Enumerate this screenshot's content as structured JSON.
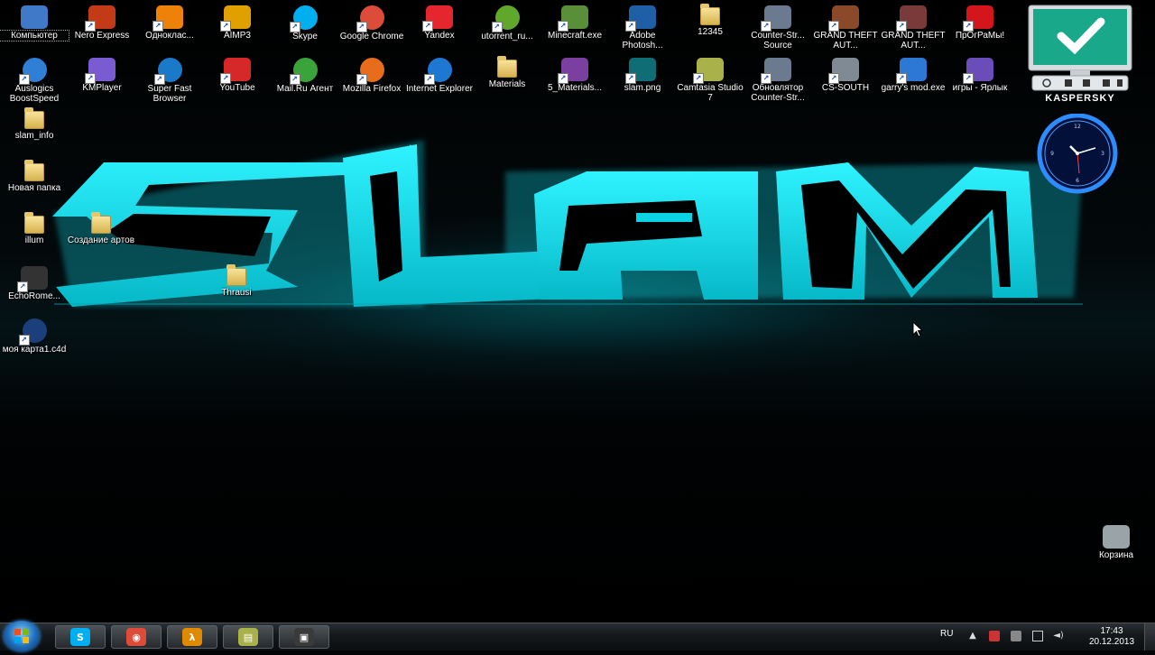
{
  "desktop_icons": [
    {
      "label": "Компьютер",
      "icon": "computer-icon",
      "color": "#3f79c8"
    },
    {
      "label": "Nero Express",
      "icon": "nero-icon",
      "color": "#c23a16"
    },
    {
      "label": "Одноклас...",
      "icon": "odnoklassniki-icon",
      "color": "#ee8208"
    },
    {
      "label": "AIMP3",
      "icon": "aimp-icon",
      "color": "#e0a100"
    },
    {
      "label": "Skype",
      "icon": "skype-icon",
      "color": "#00aff0"
    },
    {
      "label": "Google Chrome",
      "icon": "chrome-icon",
      "color": "#dd4b39"
    },
    {
      "label": "Yandex",
      "icon": "yandex-icon",
      "color": "#e6262e"
    },
    {
      "label": "utorrent_ru...",
      "icon": "utorrent-icon",
      "color": "#5fa82b"
    },
    {
      "label": "Minecraft.exe",
      "icon": "minecraft-icon",
      "color": "#5a8f3a"
    },
    {
      "label": "Adobe Photosh...",
      "icon": "photoshop-icon",
      "color": "#1f5fa5"
    },
    {
      "label": "12345",
      "icon": "folder-icon",
      "color": "#e6c86e"
    },
    {
      "label": "Counter-Str... Source",
      "icon": "counter-strike-source-icon",
      "color": "#6b7a8f"
    },
    {
      "label": "GRAND THEFT AUT...",
      "icon": "gta-icon",
      "color": "#8a4a2a"
    },
    {
      "label": "GRAND THEFT AUT...",
      "icon": "gta-icon",
      "color": "#7a3a3a"
    },
    {
      "label": "ПрОгРаМы!",
      "icon": "no-sign-icon",
      "color": "#d4161c"
    },
    {
      "label": "Auslogics BoostSpeed",
      "icon": "auslogics-icon",
      "color": "#2f7fd6"
    },
    {
      "label": "KMPlayer",
      "icon": "kmplayer-icon",
      "color": "#7a5bd1"
    },
    {
      "label": "Super Fast Browser",
      "icon": "browser-icon",
      "color": "#1b79c9"
    },
    {
      "label": "YouTube",
      "icon": "youtube-icon",
      "color": "#d62828"
    },
    {
      "label": "Mail.Ru Агент",
      "icon": "mailru-agent-icon",
      "color": "#3aa43a"
    },
    {
      "label": "Mozilla Firefox",
      "icon": "firefox-icon",
      "color": "#e76c1c"
    },
    {
      "label": "Internet Explorer",
      "icon": "internet-explorer-icon",
      "color": "#1e78d3"
    },
    {
      "label": "Materials",
      "icon": "folder-icon",
      "color": "#e6c86e"
    },
    {
      "label": "5_Materials...",
      "icon": "winrar-icon",
      "color": "#7b3fa0"
    },
    {
      "label": "slam.png",
      "icon": "image-file-icon",
      "color": "#0f6d75"
    },
    {
      "label": "Camtasia Studio 7",
      "icon": "camtasia-icon",
      "color": "#a9b24a"
    },
    {
      "label": "Обновлятор Counter-Str...",
      "icon": "updater-icon",
      "color": "#6b7a8f"
    },
    {
      "label": "CS-SOUTH",
      "icon": "cs-south-icon",
      "color": "#7f8a94"
    },
    {
      "label": "garry's mod.exe",
      "icon": "garrys-mod-icon",
      "color": "#2c78d4"
    },
    {
      "label": "игры - Ярлык",
      "icon": "games-shortcut-icon",
      "color": "#6a4db8"
    },
    {
      "label": "slam_info",
      "icon": "folder-icon",
      "color": "#e6c86e"
    },
    {
      "label": "Новая папка",
      "icon": "folder-icon",
      "color": "#e6c86e"
    },
    {
      "label": "illum",
      "icon": "folder-icon",
      "color": "#e6c86e"
    },
    {
      "label": "Создание артов",
      "icon": "folder-icon",
      "color": "#e6c86e"
    },
    {
      "label": "Thrausi",
      "icon": "folder-icon",
      "color": "#e6c86e"
    },
    {
      "label": "EchoRome...",
      "icon": "microphone-icon",
      "color": "#333333"
    },
    {
      "label": "моя карта1.c4d",
      "icon": "cinema4d-icon",
      "color": "#1b3f7a"
    },
    {
      "label": "Корзина",
      "icon": "recycle-bin-icon",
      "color": "#9aa3a8"
    }
  ],
  "gadgets": {
    "kaspersky_label": "KASPERSKY"
  },
  "taskbar": {
    "apps": [
      {
        "icon": "skype-icon",
        "color": "#00aff0"
      },
      {
        "icon": "chrome-icon",
        "color": "#dd4b39"
      },
      {
        "icon": "half-life-icon",
        "color": "#e08a00"
      },
      {
        "icon": "notes-icon",
        "color": "#a9b24a"
      },
      {
        "icon": "webcam-icon",
        "color": "#3a3a3a"
      }
    ],
    "language": "RU",
    "time": "17:43",
    "date": "20.12.2013"
  },
  "colors": {
    "accent": "#16e6f0",
    "taskbar": "#15191c"
  }
}
